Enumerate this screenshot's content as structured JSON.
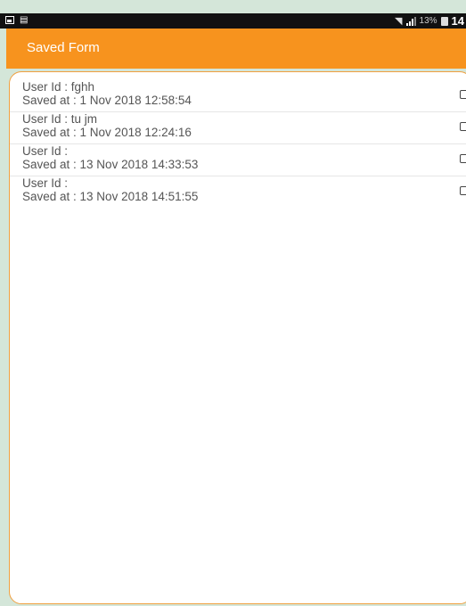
{
  "status_bar": {
    "battery_percent": "13%",
    "time": "14"
  },
  "app_bar": {
    "title": "Saved Form"
  },
  "saved_forms": [
    {
      "user_id": "User Id : fghh",
      "saved_at": "Saved at : 1 Nov 2018 12:58:54"
    },
    {
      "user_id": "User Id : tu jm",
      "saved_at": "Saved at : 1 Nov 2018 12:24:16"
    },
    {
      "user_id": "User Id :",
      "saved_at": "Saved at : 13 Nov 2018 14:33:53"
    },
    {
      "user_id": "User Id :",
      "saved_at": "Saved at : 13 Nov 2018 14:51:55"
    }
  ],
  "colors": {
    "accent": "#f7931e",
    "status_bar": "#111111",
    "text": "#555555"
  }
}
